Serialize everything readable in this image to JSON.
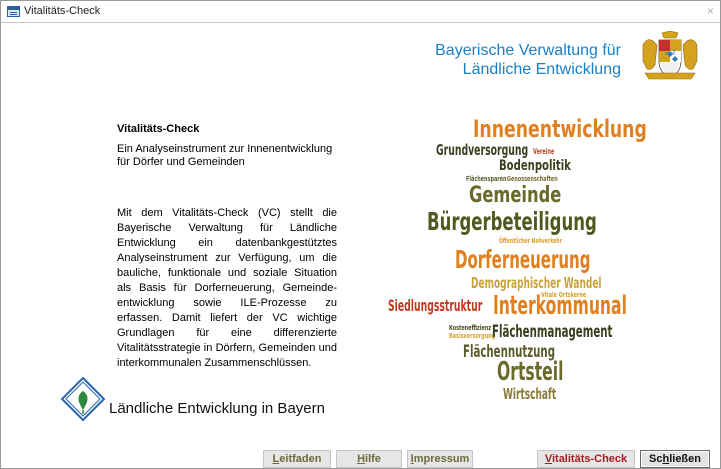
{
  "window": {
    "title": "Vitalitäts-Check",
    "close_glyph": "×"
  },
  "brand": {
    "line1": "Bayerische Verwaltung für",
    "line2": "Ländliche Entwicklung",
    "color": "#1b80c4"
  },
  "intro": {
    "heading": "Vitalitäts-Check",
    "subtitle": "Ein Analyseinstrument zur Innenentwicklung für Dörfer und Gemeinden",
    "description": "Mit dem Vitalitäts-Check (VC) stellt die Bayerische Verwaltung für Ländliche Entwicklung ein datenbankgestütztes Analyseinstrument zur Verfügung, um die bauliche, funktionale und soziale Situation als Basis für Dorferneuerung, Gemeinde-entwicklung sowie ILE-Prozesse zu erfassen. Damit liefert der VC wichtige Grundlagen für eine differenzierte Vitalitätsstrategie in Dörfern, Gemeinden und interkommunalen Zusammenschlüssen."
  },
  "logo": {
    "text": "Ländliche Entwicklung in Bayern",
    "icon": "ale-logo-icon"
  },
  "word_cloud": {
    "words": [
      {
        "text": "Innenentwicklung",
        "color": "#e0801f"
      },
      {
        "text": "Grundversorgung",
        "color": "#3b3f1e"
      },
      {
        "text": "Vereine",
        "color": "#c0461f"
      },
      {
        "text": "Bodenpolitik",
        "color": "#3b3f1e"
      },
      {
        "text": "Flächensparen",
        "color": "#5a5a2a"
      },
      {
        "text": "Genossenschaften",
        "color": "#7a6a30"
      },
      {
        "text": "Gemeinde",
        "color": "#6a6a2a"
      },
      {
        "text": "Bürgerbeteiligung",
        "color": "#4f5a1f"
      },
      {
        "text": "Öffentlicher Nahverkehr",
        "color": "#d9a02a"
      },
      {
        "text": "Dorferneuerung",
        "color": "#e0801f"
      },
      {
        "text": "Demographischer Wandel",
        "color": "#c9a23a"
      },
      {
        "text": "Vitale Ortskerne",
        "color": "#d9a02a"
      },
      {
        "text": "Siedlungsstruktur",
        "color": "#c0391f"
      },
      {
        "text": "Interkommunal",
        "color": "#e0801f"
      },
      {
        "text": "Kosteneffizienz",
        "color": "#4a4a1f"
      },
      {
        "text": "Basisversorgung",
        "color": "#d9a02a"
      },
      {
        "text": "Flächenmanagement",
        "color": "#3b3f1e"
      },
      {
        "text": "Flächennutzung",
        "color": "#5a5a2a"
      },
      {
        "text": "Ortsteil",
        "color": "#6a6a2a"
      },
      {
        "text": "Wirtschaft",
        "color": "#8a7a35"
      }
    ]
  },
  "buttons": {
    "leitfaden": {
      "acc": "L",
      "rest": "eitfaden"
    },
    "hilfe": {
      "acc": "H",
      "rest": "ilfe"
    },
    "impressum": {
      "acc": "I",
      "rest": "mpressum"
    },
    "vitalitaets_check": {
      "acc": "V",
      "rest": "italitäts-Check"
    },
    "schliessen": {
      "pre": "Sc",
      "acc": "h",
      "rest": "ließen"
    }
  }
}
